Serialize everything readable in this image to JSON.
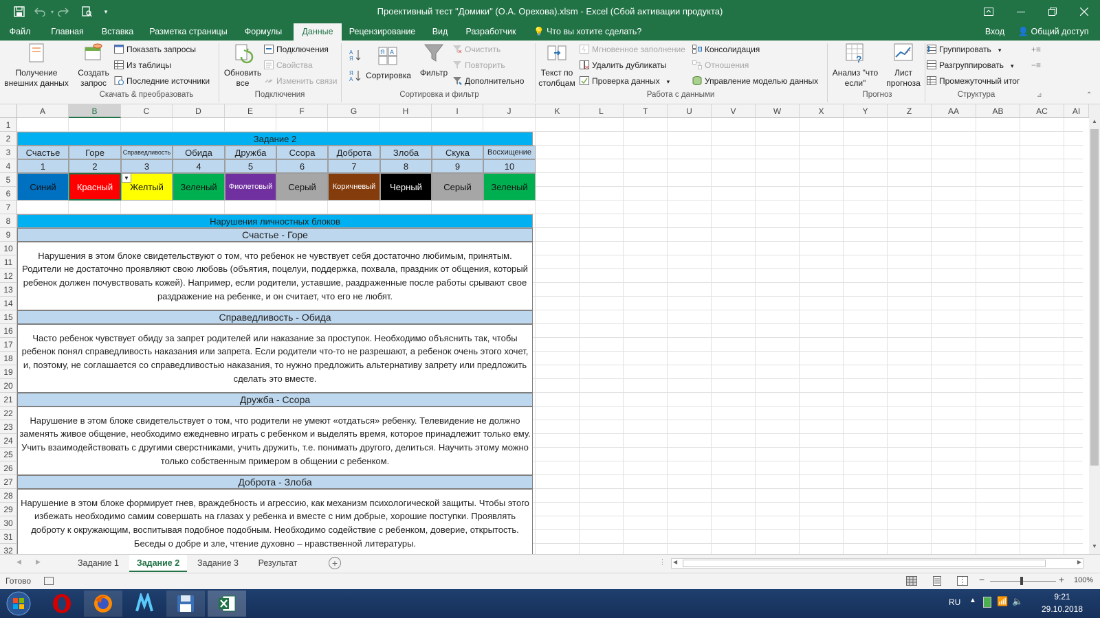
{
  "window": {
    "title": "Проективный тест \"Домики\" (О.А. Орехова).xlsm - Excel (Сбой активации продукта)",
    "signin": "Вход",
    "share": "Общий доступ"
  },
  "tabs": [
    "Файл",
    "Главная",
    "Вставка",
    "Разметка страницы",
    "Формулы",
    "Данные",
    "Рецензирование",
    "Вид",
    "Разработчик"
  ],
  "active_tab": "Данные",
  "tellme": "Что вы хотите сделать?",
  "ribbon": {
    "get_external": "Получение внешних данных",
    "create_query": "Создать запрос",
    "show_queries": "Показать запросы",
    "from_table": "Из таблицы",
    "recent_sources": "Последние источники",
    "refresh_all": "Обновить все",
    "connections": "Подключения",
    "properties": "Свойства",
    "edit_links": "Изменить связи",
    "sort": "Сортировка",
    "filter": "Фильтр",
    "clear": "Очистить",
    "reapply": "Повторить",
    "advanced": "Дополнительно",
    "text_to_columns": "Текст по столбцам",
    "flash_fill": "Мгновенное заполнение",
    "remove_dupes": "Удалить дубликаты",
    "validation": "Проверка данных",
    "consolidate": "Консолидация",
    "relationships": "Отношения",
    "manage_model": "Управление моделью данных",
    "whatif": "Анализ \"что если\"",
    "forecast_sheet": "Лист прогноза",
    "group": "Группировать",
    "ungroup": "Разгруппировать",
    "subtotal": "Промежуточный итог",
    "groups": {
      "get_transform": "Скачать & преобразовать",
      "connections": "Подключения",
      "sort_filter": "Сортировка и фильтр",
      "data_tools": "Работа с данными",
      "forecast": "Прогноз",
      "outline": "Структура"
    }
  },
  "columns": [
    "A",
    "B",
    "C",
    "D",
    "E",
    "F",
    "G",
    "H",
    "I",
    "J",
    "K",
    "L",
    "T",
    "U",
    "V",
    "W",
    "X",
    "Y",
    "Z",
    "AA",
    "AB",
    "AC",
    "AI"
  ],
  "rows": [
    "1",
    "2",
    "3",
    "4",
    "5",
    "6",
    "7",
    "8",
    "9",
    "10",
    "11",
    "12",
    "13",
    "14",
    "15",
    "16",
    "17",
    "18",
    "19",
    "20",
    "21",
    "22",
    "23",
    "24",
    "25",
    "26",
    "27",
    "28",
    "29",
    "30",
    "31",
    "32"
  ],
  "sheet": {
    "task_title": "Задание 2",
    "headers": [
      "Счастье",
      "Горе",
      "Справедливость",
      "Обида",
      "Дружба",
      "Ссора",
      "Доброта",
      "Злоба",
      "Скука",
      "Восхищение"
    ],
    "numbers": [
      "1",
      "2",
      "3",
      "4",
      "5",
      "6",
      "7",
      "8",
      "9",
      "10"
    ],
    "colors": [
      "Синий",
      "Красный",
      "Желтый",
      "Зеленый",
      "Фиолетовый",
      "Серый",
      "Коричневый",
      "Черный",
      "Серый",
      "Зеленый"
    ],
    "color_fills": [
      "#0070c0",
      "#ff0000",
      "#ffff00",
      "#00b050",
      "#7030a0",
      "#a6a6a6",
      "#843c0c",
      "#000000",
      "#a6a6a6",
      "#00b050"
    ],
    "violations_title": "Нарушения личностных блоков",
    "sections": [
      {
        "title": "Счастье - Горе",
        "text": "Нарушения в этом блоке свидетельствуют о том, что ребенок не чувствует себя достаточно любимым, принятым. Родители не достаточно проявляют свою любовь (объятия, поцелуи, поддержка, похвала, праздник от общения, который ребенок должен почувствовать кожей). Например, если родители, уставшие, раздраженные после работы срывают свое раздражение на ребенке, и он считает, что его не любят."
      },
      {
        "title": "Справедливость - Обида",
        "text": "Часто ребенок чувствует обиду за запрет родителей или наказание за проступок. Необходимо объяснить так, чтобы ребенок понял справедливость наказания или запрета. Если родители что-то не разрешают, а ребенок очень этого хочет, и, поэтому, не соглашается со справедливостью наказания, то нужно предложить альтернативу запрету или предложить сделать это вместе."
      },
      {
        "title": "Дружба - Ссора",
        "text": "Нарушение в этом блоке свидетельствует о том, что родители не умеют «отдаться» ребенку. Телевидение не должно заменять живое общение, необходимо ежедневно играть с ребенком и выделять время, которое принадлежит только ему. Учить взаимодействовать с другими сверстниками, учить дружить, т.е. понимать другого, делиться. Научить этому можно только собственным примером в общении с ребенком."
      },
      {
        "title": "Доброта - Злоба",
        "text": "Нарушение в этом блоке формирует гнев, враждебность и агрессию, как механизм психологической защиты. Чтобы этого избежать необходимо самим совершать на глазах у ребенка и вместе с ним добрые, хорошие поступки. Проявлять доброту к окружающим, воспитывая подобное подобным. Необходимо содействие с ребенком, доверие, открытость. Беседы о добре и зле, чтение духовно – нравственной литературы."
      }
    ]
  },
  "sheet_tabs": [
    "Задание 1",
    "Задание 2",
    "Задание 3",
    "Результат"
  ],
  "active_sheet": "Задание 2",
  "status": {
    "ready": "Готово",
    "zoom": "100%"
  },
  "taskbar": {
    "lang": "RU",
    "time": "9:21",
    "date": "29.10.2018"
  }
}
